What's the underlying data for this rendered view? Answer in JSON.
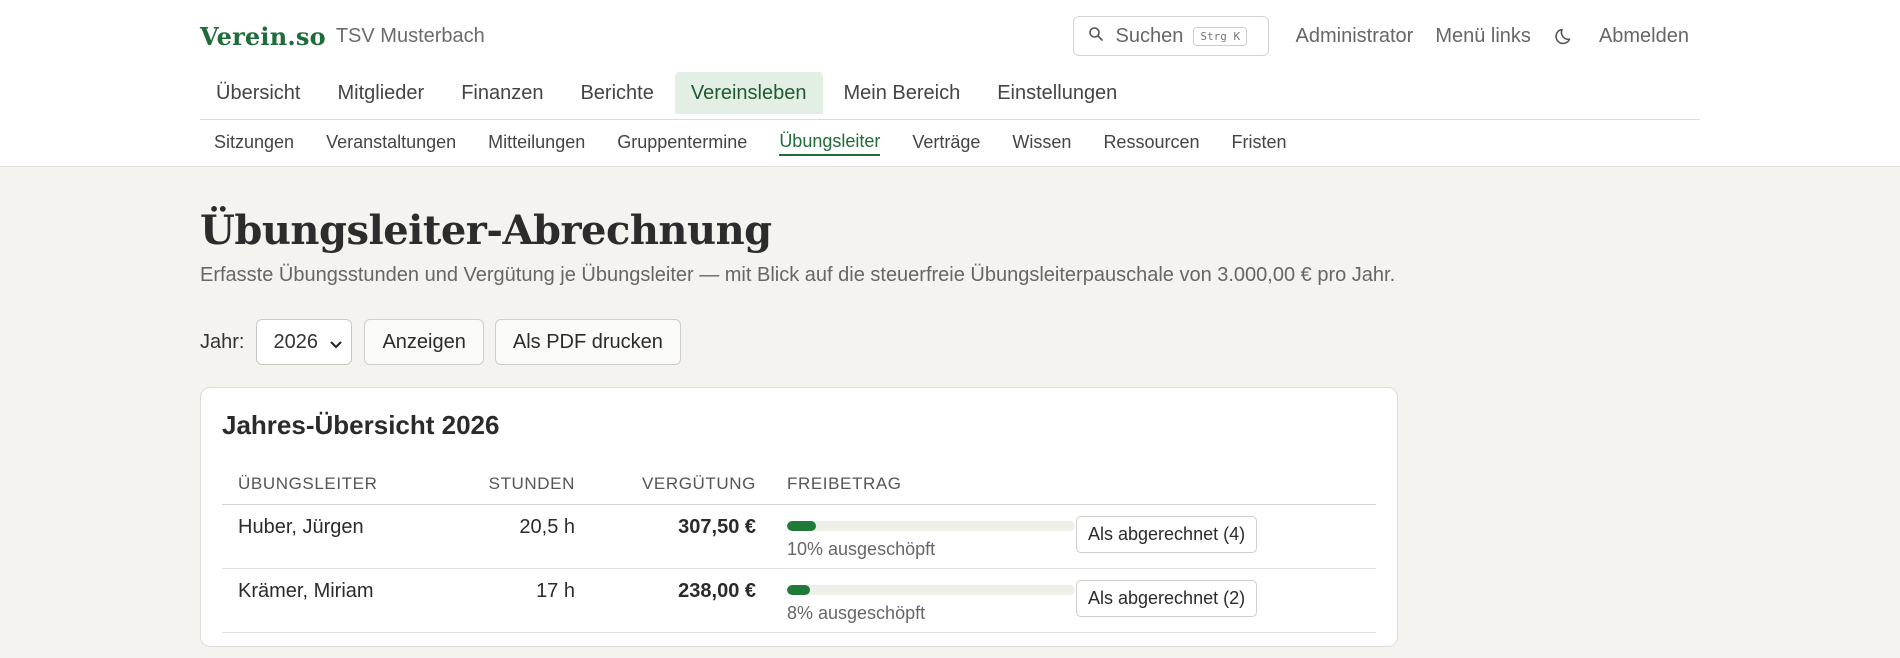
{
  "header": {
    "logo": "Verein.so",
    "club": "TSV Musterbach",
    "search_label": "Suchen",
    "search_kbd": "Strg K",
    "links": [
      "Administrator",
      "Menü links",
      "Abmelden"
    ]
  },
  "main_nav": [
    {
      "label": "Übersicht",
      "active": false
    },
    {
      "label": "Mitglieder",
      "active": false
    },
    {
      "label": "Finanzen",
      "active": false
    },
    {
      "label": "Berichte",
      "active": false
    },
    {
      "label": "Vereinsleben",
      "active": true
    },
    {
      "label": "Mein Bereich",
      "active": false
    },
    {
      "label": "Einstellungen",
      "active": false
    }
  ],
  "sub_nav": [
    {
      "label": "Sitzungen",
      "active": false
    },
    {
      "label": "Veranstaltungen",
      "active": false
    },
    {
      "label": "Mitteilungen",
      "active": false
    },
    {
      "label": "Gruppentermine",
      "active": false
    },
    {
      "label": "Übungsleiter",
      "active": true
    },
    {
      "label": "Verträge",
      "active": false
    },
    {
      "label": "Wissen",
      "active": false
    },
    {
      "label": "Ressourcen",
      "active": false
    },
    {
      "label": "Fristen",
      "active": false
    }
  ],
  "page": {
    "title": "Übungsleiter-Abrechnung",
    "subtitle": "Erfasste Übungsstunden und Vergütung je Übungsleiter — mit Blick auf die steuerfreie Übungsleiterpauschale von 3.000,00 € pro Jahr."
  },
  "controls": {
    "year_label": "Jahr:",
    "year_value": "2026",
    "show_button": "Anzeigen",
    "pdf_button": "Als PDF drucken"
  },
  "card": {
    "title": "Jahres-Übersicht 2026",
    "columns": [
      "ÜBUNGSLEITER",
      "STUNDEN",
      "VERGÜTUNG",
      "FREIBETRAG"
    ],
    "rows": [
      {
        "name": "Huber, Jürgen",
        "hours": "20,5 h",
        "amount": "307,50 €",
        "usage_percent": 10,
        "usage_text": "10% ausgeschöpft",
        "action": "Als abgerechnet (4)"
      },
      {
        "name": "Krämer, Miriam",
        "hours": "17 h",
        "amount": "238,00 €",
        "usage_percent": 8,
        "usage_text": "8% ausgeschöpft",
        "action": "Als abgerechnet (2)"
      }
    ]
  },
  "colors": {
    "brand": "#1f6b3a",
    "active_tab_bg": "#e3efe4",
    "progress": "#1f7a3a"
  },
  "icons": {
    "search": "search-icon",
    "theme": "moon-icon",
    "select": "chevron-down-icon"
  }
}
